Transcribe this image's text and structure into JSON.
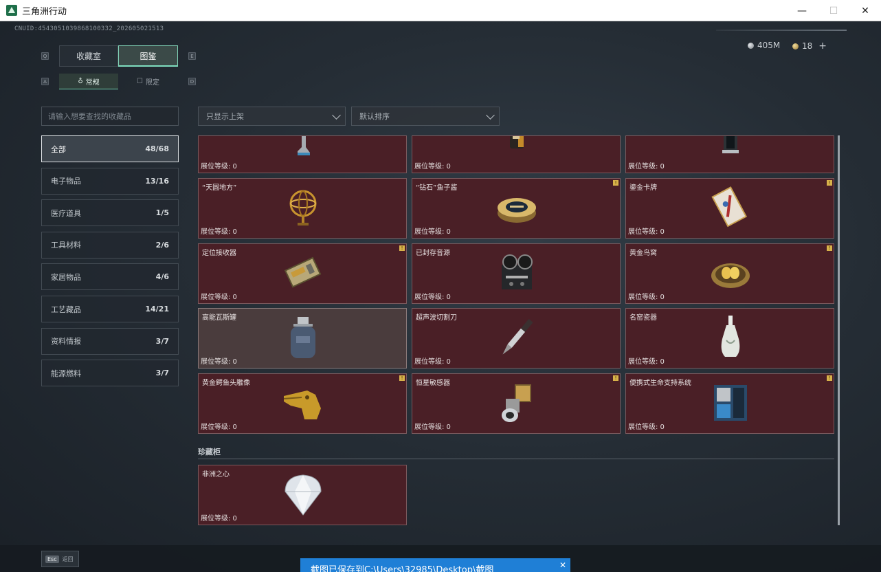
{
  "window": {
    "title": "三角洲行动",
    "minimize": "—",
    "maximize": "☐",
    "close": "✕"
  },
  "header": {
    "uid": "CNUID:4543051039868100332_202605021513",
    "currency_silver": "405M",
    "currency_gold": "18",
    "add_label": "+"
  },
  "tabs": {
    "key_left": "Q",
    "key_right": "E",
    "items": [
      "收藏室",
      "图鉴"
    ],
    "active": 1
  },
  "subtabs": {
    "key_left": "A",
    "key_right": "D",
    "items": [
      "常规",
      "限定"
    ],
    "active": 0
  },
  "filters": {
    "search_placeholder": "请输入想要查找的收藏品",
    "shelf_filter": "只显示上架",
    "sort": "默认排序"
  },
  "categories": [
    {
      "label": "全部",
      "count": "48/68",
      "active": true
    },
    {
      "label": "电子物品",
      "count": "13/16"
    },
    {
      "label": "医疗道具",
      "count": "1/5"
    },
    {
      "label": "工具材料",
      "count": "2/6"
    },
    {
      "label": "家居物品",
      "count": "4/6"
    },
    {
      "label": "工艺藏品",
      "count": "14/21"
    },
    {
      "label": "资料情报",
      "count": "3/7"
    },
    {
      "label": "能源燃料",
      "count": "3/7"
    }
  ],
  "level_label": "展位等级: 0",
  "badge_glyph": "!",
  "cards": [
    {
      "name": "",
      "icon": "boot-icon"
    },
    {
      "name": "",
      "icon": "bottle-icon"
    },
    {
      "name": "",
      "icon": "lantern-icon"
    },
    {
      "name": "“天圆地方”",
      "icon": "armillary-sphere-icon"
    },
    {
      "name": "“钻石”鱼子酱",
      "icon": "caviar-tin-icon",
      "badge": true
    },
    {
      "name": "鎏金卡牌",
      "icon": "gilded-card-icon",
      "badge": true
    },
    {
      "name": "定位接收器",
      "icon": "locator-receiver-icon",
      "badge": true
    },
    {
      "name": "已封存音源",
      "icon": "reel-recorder-icon"
    },
    {
      "name": "黄金鸟窝",
      "icon": "golden-nest-icon",
      "badge": true
    },
    {
      "name": "高能瓦斯罐",
      "icon": "gas-canister-icon",
      "highlight": true
    },
    {
      "name": "超声波切割刀",
      "icon": "ultrasonic-cutter-icon"
    },
    {
      "name": "名窑瓷器",
      "icon": "porcelain-vase-icon"
    },
    {
      "name": "黄金鳄鱼头雕像",
      "icon": "gold-crocodile-icon",
      "badge": true
    },
    {
      "name": "恒星敏感器",
      "icon": "star-sensor-icon",
      "badge": true
    },
    {
      "name": "便携式生命支持系统",
      "icon": "life-support-icon",
      "badge": true
    }
  ],
  "treasure_section": {
    "title": "珍藏柜",
    "cards": [
      {
        "name": "非洲之心",
        "icon": "diamond-icon"
      }
    ]
  },
  "footer": {
    "esc_key": "Esc",
    "esc_label": "返回"
  },
  "toast": {
    "text": "截图已保存到C:\\Users\\32985\\Desktop\\截图",
    "close": "✕"
  },
  "colors": {
    "card_bg": "#4a1f26",
    "accent": "#7fe0c0",
    "toast": "#1f7fd6"
  }
}
